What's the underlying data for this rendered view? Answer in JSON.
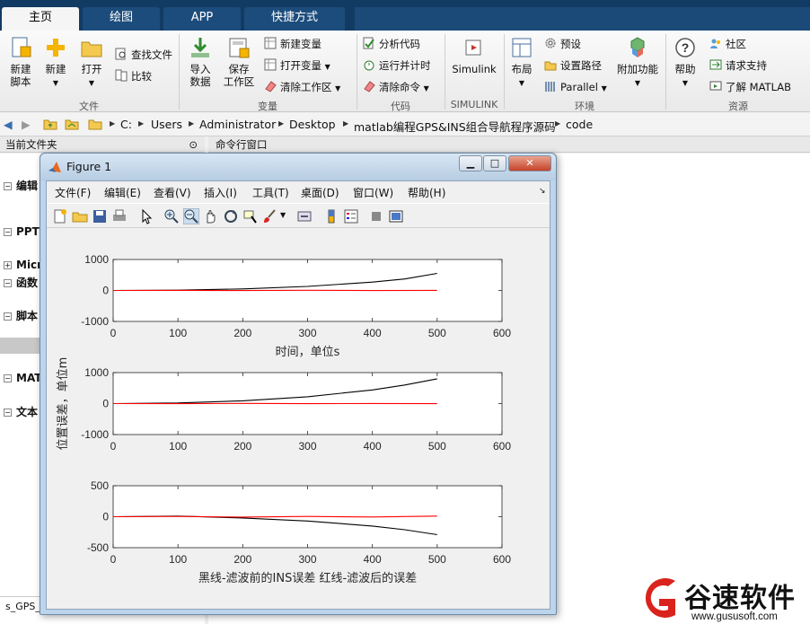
{
  "ribbon": {
    "tabs": [
      "主页",
      "绘图",
      "APP",
      "快捷方式"
    ],
    "file": {
      "new_script": [
        "新建",
        "脚本"
      ],
      "new": "新建",
      "open": "打开",
      "find_files": "查找文件",
      "compare": "比较",
      "group": "文件"
    },
    "variable": {
      "import": [
        "导入",
        "数据"
      ],
      "save": [
        "保存",
        "工作区"
      ],
      "new_var": "新建变量",
      "open_var": "打开变量",
      "clear_ws": "清除工作区",
      "group": "变量"
    },
    "code": {
      "analyze": "分析代码",
      "run_time": "运行并计时",
      "clear_cmd": "清除命令",
      "group": "代码"
    },
    "simulink": {
      "label": "Simulink",
      "group": "SIMULINK"
    },
    "env": {
      "layout": "布局",
      "prefs": "预设",
      "set_path": "设置路径",
      "parallel": "Parallel",
      "addons": "附加功能",
      "group": "环境"
    },
    "res": {
      "help": "帮助",
      "community": "社区",
      "support": "请求支持",
      "learn": "了解 MATLAB",
      "group": "资源"
    }
  },
  "address": [
    "C:",
    "Users",
    "Administrator",
    "Desktop",
    "matlab编程GPS&INS组合导航程序源码",
    "code"
  ],
  "panels": {
    "current_folder": "当前文件夹",
    "command_window": "命令行窗口",
    "bottom_file": "s_GPS_"
  },
  "tree": [
    "编辑",
    "PPT",
    "Micr",
    "函数",
    "脚本",
    "MAT",
    "文本"
  ],
  "figure": {
    "title": "Figure 1",
    "menu": [
      "文件(F)",
      "编辑(E)",
      "查看(V)",
      "插入(I)",
      "工具(T)",
      "桌面(D)",
      "窗口(W)",
      "帮助(H)"
    ]
  },
  "chart_data": [
    {
      "type": "line",
      "xlabel": "时间，单位s",
      "ylabel": "",
      "xlim": [
        0,
        600
      ],
      "ylim": [
        -1000,
        1000
      ],
      "xticks": [
        0,
        100,
        200,
        300,
        400,
        500,
        600
      ],
      "yticks": [
        -1000,
        0,
        1000
      ],
      "series": [
        {
          "color": "#000000",
          "x": [
            0,
            100,
            200,
            300,
            400,
            450,
            500
          ],
          "y": [
            0,
            10,
            50,
            130,
            270,
            370,
            550
          ]
        },
        {
          "color": "#ff0000",
          "x": [
            0,
            100,
            200,
            300,
            400,
            500
          ],
          "y": [
            0,
            3,
            -4,
            5,
            -3,
            2
          ]
        }
      ]
    },
    {
      "type": "line",
      "xlabel": "",
      "ylabel": "位置误差，单位m",
      "xlim": [
        0,
        600
      ],
      "ylim": [
        -1000,
        1000
      ],
      "xticks": [
        0,
        100,
        200,
        300,
        400,
        500,
        600
      ],
      "yticks": [
        -1000,
        0,
        1000
      ],
      "series": [
        {
          "color": "#000000",
          "x": [
            0,
            100,
            200,
            300,
            400,
            450,
            500
          ],
          "y": [
            0,
            20,
            90,
            220,
            440,
            600,
            800
          ]
        },
        {
          "color": "#ff0000",
          "x": [
            0,
            100,
            200,
            300,
            400,
            500
          ],
          "y": [
            0,
            -4,
            5,
            -2,
            4,
            -3
          ]
        }
      ]
    },
    {
      "type": "line",
      "xlabel": "黑线-滤波前的INS误差   红线-滤波后的误差",
      "ylabel": "",
      "xlim": [
        0,
        600
      ],
      "ylim": [
        -500,
        500
      ],
      "xticks": [
        0,
        100,
        200,
        300,
        400,
        500,
        600
      ],
      "yticks": [
        -500,
        0,
        500
      ],
      "series": [
        {
          "color": "#000000",
          "x": [
            0,
            100,
            200,
            300,
            400,
            450,
            500
          ],
          "y": [
            0,
            10,
            -20,
            -70,
            -150,
            -210,
            -290
          ]
        },
        {
          "color": "#ff0000",
          "x": [
            0,
            100,
            200,
            300,
            400,
            500
          ],
          "y": [
            0,
            5,
            -6,
            4,
            -5,
            10
          ]
        }
      ]
    }
  ],
  "watermark": {
    "brand": "谷速软件",
    "url": "www.gususoft.com"
  }
}
